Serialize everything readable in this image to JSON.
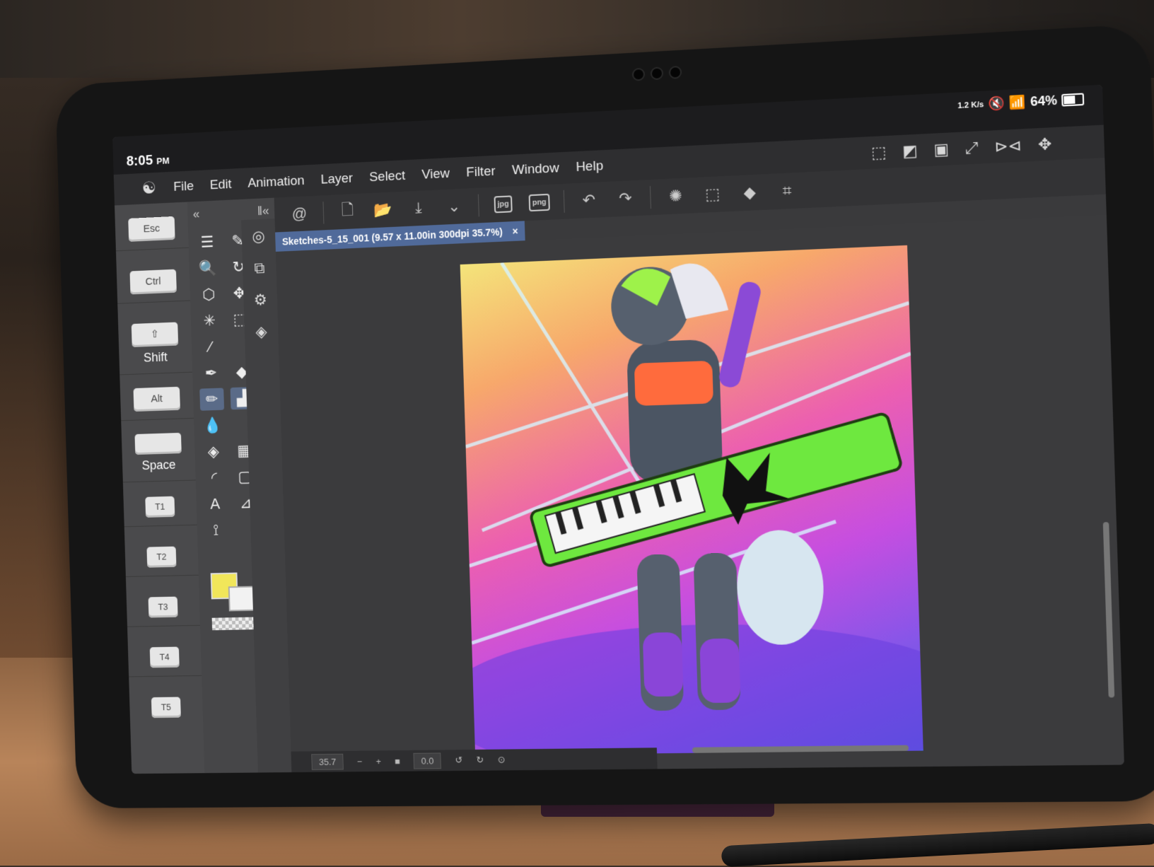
{
  "status": {
    "time": "8:05",
    "ampm": "PM",
    "speed": "1.2 K/s",
    "battery": "64%"
  },
  "menu": {
    "items": [
      "File",
      "Edit",
      "Animation",
      "Layer",
      "Select",
      "View",
      "Filter",
      "Window",
      "Help"
    ]
  },
  "toolbar": {
    "jpg_label": "jpg",
    "png_label": "png"
  },
  "modifier_keys": {
    "esc": "Esc",
    "ctrl": "Ctrl",
    "shift_cap": "⇧",
    "shift": "Shift",
    "alt": "Alt",
    "space": "Space",
    "t1": "T1",
    "t2": "T2",
    "t3": "T3",
    "t4": "T4",
    "t5": "T5"
  },
  "document": {
    "tab_title": "Sketches-5_15_001 (9.57 x 11.00in 300dpi 35.7%)",
    "close": "×"
  },
  "bottombar": {
    "zoom": "35.7",
    "rotation": "0.0"
  },
  "colors": {
    "main": "#f1e65a",
    "sub": "#f2f2f2",
    "accent": "#506a9a"
  }
}
